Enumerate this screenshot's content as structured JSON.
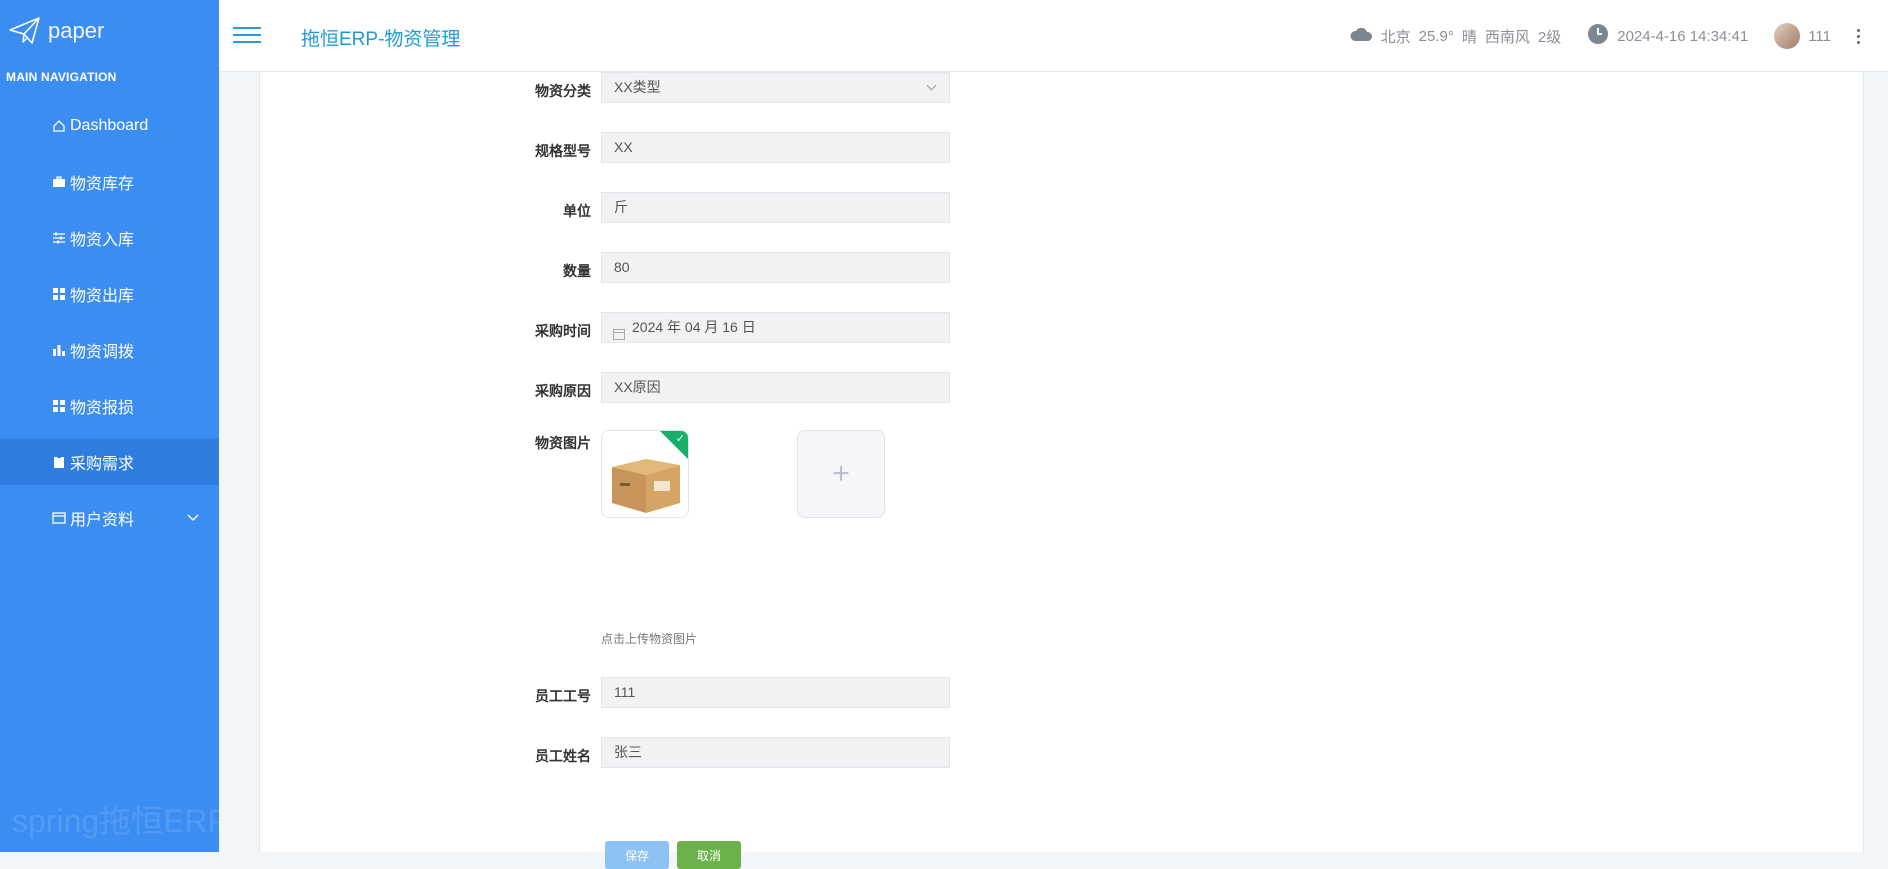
{
  "brand": {
    "logo_text": "paper",
    "nav_header": "MAIN NAVIGATION",
    "watermark": "spring拖恒ERP"
  },
  "sidebar": {
    "items": [
      {
        "label": "Dashboard",
        "icon": "home-icon"
      },
      {
        "label": "物资库存",
        "icon": "briefcase-icon"
      },
      {
        "label": "物资入库",
        "icon": "sliders-icon"
      },
      {
        "label": "物资出库",
        "icon": "grid-icon"
      },
      {
        "label": "物资调拨",
        "icon": "bar-chart-icon"
      },
      {
        "label": "物资报损",
        "icon": "grid-icon"
      },
      {
        "label": "采购需求",
        "icon": "clipboard-icon",
        "active": true
      },
      {
        "label": "用户资料",
        "icon": "card-icon",
        "expandable": true
      }
    ]
  },
  "header": {
    "title": "拖恒ERP-物资管理",
    "weather": {
      "city": "北京",
      "temp": "25.9°",
      "condition": "晴",
      "wind": "西南风",
      "level": "2级"
    },
    "datetime": "2024-4-16 14:34:41",
    "user": "111"
  },
  "form": {
    "category": {
      "label": "物资分类",
      "value": "XX类型"
    },
    "model": {
      "label": "规格型号",
      "value": "XX"
    },
    "unit": {
      "label": "单位",
      "value": "斤"
    },
    "quantity": {
      "label": "数量",
      "value": "80"
    },
    "purchase_date": {
      "label": "采购时间",
      "value": "2024 年 04 月 16 日"
    },
    "reason": {
      "label": "采购原因",
      "value": "XX原因"
    },
    "image": {
      "label": "物资图片",
      "hint": "点击上传物资图片"
    },
    "employee_id": {
      "label": "员工工号",
      "value": "111"
    },
    "employee_name": {
      "label": "员工姓名",
      "value": "张三"
    },
    "save_label": "保存",
    "cancel_label": "取消"
  },
  "colors": {
    "sidebar": "#3c8df2",
    "accent": "#1e9bd7",
    "cancel": "#6cb24a",
    "save": "#8cc3f3"
  }
}
